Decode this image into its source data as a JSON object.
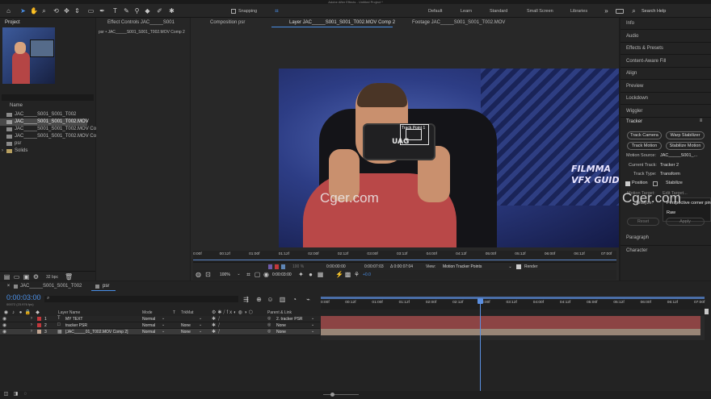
{
  "app_title": "Adobe After Effects - Untitled Project *",
  "toolbar": {
    "snapping_label": "Snapping",
    "workspaces": [
      "Default",
      "Learn",
      "Standard",
      "Small Screen",
      "Libraries"
    ],
    "search_placeholder": "Search Help"
  },
  "project_panel": {
    "tab": "Project",
    "name_header": "Name",
    "items": [
      {
        "label": "JAC_____S001_S001_T002",
        "selected": false
      },
      {
        "label": "JAC_____S001_S001_T002.MOV",
        "selected": true
      },
      {
        "label": "JAC_____S001_S001_T002.MOV Co",
        "selected": false
      },
      {
        "label": "JAC_____S001_S001_T002.MOV Co",
        "selected": false
      },
      {
        "label": "psr",
        "selected": false
      },
      {
        "label": "Solids",
        "selected": false
      }
    ],
    "bpc": "32 bpc"
  },
  "effect_controls": {
    "tab": "Effect Controls JAC_____S001",
    "path": "psr • JAC_____S001_S001_T002.MOV Comp 2"
  },
  "viewer": {
    "tabs": [
      "Composition psr",
      "Layer JAC_____S001_S001_T002.MOV Comp 2",
      "Footage JAC_____S001_S001_T002.MOV"
    ],
    "track_point_label": "Track Point 1",
    "bg_text": "FILMMA\nVFX GUID",
    "ruler_ticks": [
      "0:00f",
      "00:12f",
      "01:00f",
      "01:12f",
      "02:00f",
      "02:12f",
      "03:00f",
      "03:12f",
      "04:00f",
      "04:12f",
      "05:00f",
      "05:12f",
      "06:00f",
      "06:12f",
      "07:00f"
    ],
    "zoom_pct": "100 %",
    "in_time": "0:00:00:00",
    "out_time": "0:00:07:03",
    "duration": "Δ 0:00:07:04",
    "view_label": "View:",
    "view_value": "Motion Tracker Points",
    "render_label": "Render",
    "zoom": "100%",
    "current_time": "0:00:03:00",
    "exposure": "+0.0"
  },
  "watermark": "Cger.com",
  "right_panel": {
    "items": [
      "Info",
      "Audio",
      "Effects & Presets",
      "Content-Aware Fill",
      "Align",
      "Preview",
      "Lockdown",
      "Wiggler"
    ],
    "tracker": {
      "title": "Tracker",
      "buttons": [
        "Track Camera",
        "Warp Stabilizer",
        "Track Motion",
        "Stabilize Motion"
      ],
      "motion_source_label": "Motion Source:",
      "motion_source_value": "JAC_____S001_...",
      "current_track_label": "Current Track:",
      "current_track_value": "Tracker 2",
      "track_type_label": "Track Type:",
      "track_type_value": "Transform",
      "position_label": "Position",
      "stabilize_label": "Stabilize",
      "motion_target_label": "Motion Target:",
      "edit_target_label": "Edit Target...",
      "analyze_label": "Analyze:",
      "reset_label": "Reset",
      "apply_label": "Apply",
      "dropdown_options": [
        "Perspective corner pin",
        "Raw"
      ]
    },
    "bottom_items": [
      "Paragraph",
      "Character"
    ]
  },
  "timeline": {
    "tabs": [
      "JAC_____S001_S001_T002",
      "psr"
    ],
    "timecode": "0:00:03:00",
    "timecode_sub": "00072 (23.976 fps)",
    "search_placeholder": "",
    "headers": {
      "layer_name": "Layer Name",
      "mode": "Mode",
      "t": "T",
      "trkmat": "TrkMat",
      "parent": "Parent & Link"
    },
    "layers": [
      {
        "num": "1",
        "name": "MY TEXT",
        "mode": "Normal",
        "trkmat": "",
        "parent": "2. tracker PSR",
        "color": "#c2383c",
        "type": "T"
      },
      {
        "num": "2",
        "name": "tracker PSR",
        "mode": "Normal",
        "trkmat": "None",
        "parent": "None",
        "color": "#c2383c",
        "type": "□"
      },
      {
        "num": "3",
        "name": "[JAC_____01_T002.MOV Comp 2]",
        "mode": "Normal",
        "trkmat": "None",
        "parent": "None",
        "color": "#c2a591",
        "type": "▦"
      }
    ],
    "ruler_ticks": [
      "0:00f",
      "00:12f",
      "01:00f",
      "01:12f",
      "02:00f",
      "02:12f",
      "03:00f",
      "03:12f",
      "04:00f",
      "04:12f",
      "05:00f",
      "05:12f",
      "06:00f",
      "06:12f",
      "07:00f"
    ],
    "playhead_fraction": 0.42
  }
}
